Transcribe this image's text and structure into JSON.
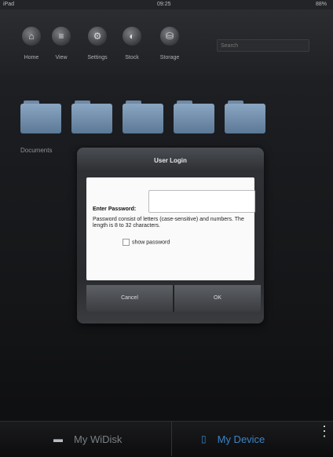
{
  "status": {
    "carrier": "iPad",
    "time": "09:25",
    "battery": "88%"
  },
  "toolbar": {
    "buttons": [
      {
        "label": "Home",
        "icon": "home-icon"
      },
      {
        "label": "View",
        "icon": "list-icon"
      },
      {
        "label": "Settings",
        "icon": "gear-icon"
      },
      {
        "label": "Stock",
        "icon": "stock-icon"
      },
      {
        "label": "Storage",
        "icon": "storage-icon"
      }
    ],
    "search_placeholder": "Search"
  },
  "folders": {
    "count": 5,
    "first_caption": "Documents"
  },
  "dialog": {
    "title": "User Login",
    "password_label": "Enter Password:",
    "password_value": "",
    "help_text": "Password consist of letters (case-sensitive) and numbers. The length is 8 to 32 characters.",
    "show_password_label": "show password",
    "cancel_label": "Cancel",
    "ok_label": "OK"
  },
  "tabs": [
    {
      "label": "My WiDisk",
      "icon": "drive-icon",
      "active": false
    },
    {
      "label": "My Device",
      "icon": "device-icon",
      "active": true
    }
  ],
  "colors": {
    "accent": "#3a84c7",
    "folder": "#7896b4"
  }
}
